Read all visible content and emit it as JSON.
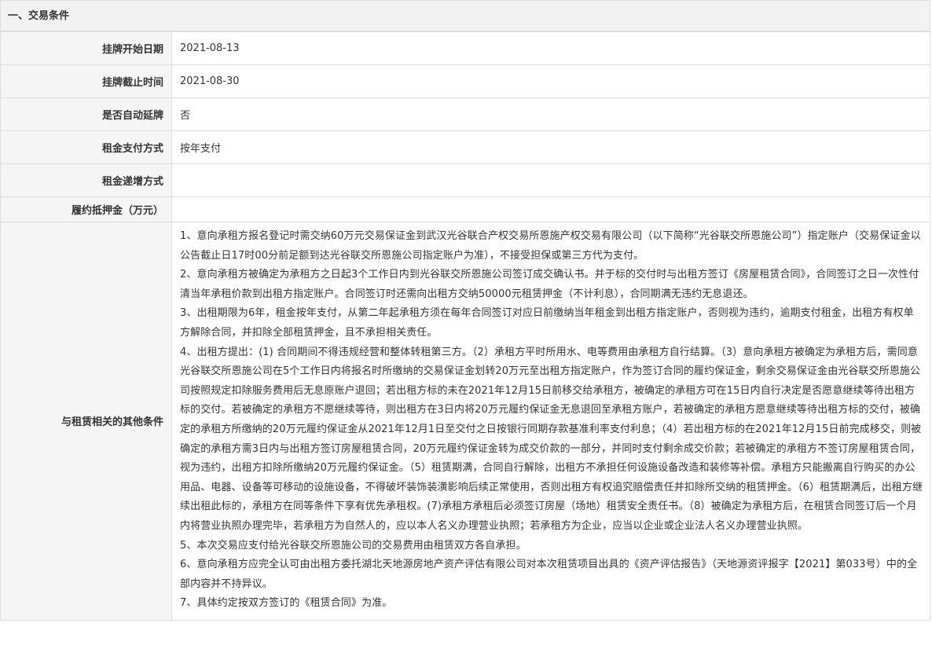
{
  "section": {
    "title": "一、交易条件"
  },
  "rows": [
    {
      "label": "挂牌开始日期",
      "value": "2021-08-13"
    },
    {
      "label": "挂牌截止时间",
      "value": "2021-08-30"
    },
    {
      "label": "是否自动延牌",
      "value": "否"
    },
    {
      "label": "租金支付方式",
      "value": "按年支付"
    },
    {
      "label": "租金递增方式",
      "value": ""
    },
    {
      "label": "履约抵押金（万元）",
      "value": ""
    }
  ],
  "other_conditions": {
    "label": "与租赁相关的其他条件",
    "paragraphs": [
      "1、意向承租方报名登记时需交纳60万元交易保证金到武汉光谷联合产权交易所恩施产权交易有限公司（以下简称“光谷联交所恩施公司”）指定账户（交易保证金以公告截止日17时00分前足额到达光谷联交所恩施公司指定账户为准），不接受担保或第三方代为支付。",
      " 2、意向承租方被确定为承租方之日起3个工作日内到光谷联交所恩施公司签订成交确认书。并于标的交付时与出租方签订《房屋租赁合同》，合同签订之日一次性付清当年承租价款到出租方指定账户。合同签订时还需向出租方交纳50000元租赁押金（不计利息），合同期满无违约无息退还。",
      "3、出租期限为6年，租金按年支付，从第二年起承租方须在每年合同签订对应日前缴纳当年租金到出租方指定账户，否则视为违约，逾期支付租金，出租方有权单方解除合同，并扣除全部租赁押金，且不承担相关责任。",
      "4、出租方提出：(1) 合同期间不得违规经营和整体转租第三方。（2）承租方平时所用水、电等费用由承租方自行结算。（3）意向承租方被确定为承租方后，需同意光谷联交所恩施公司在5个工作日内将报名时所缴纳的交易保证金划转20万元至出租方指定账户，作为签订合同的履约保证金，剩余交易保证金由光谷联交所恩施公司按照规定扣除服务费用后无息原账户退回；若出租方标的未在2021年12月15日前移交给承租方，被确定的承租方可在15日内自行决定是否愿意继续等待出租方标的交付。若被确定的承租方不愿继续等待，则出租方在3日内将20万元履约保证金无息退回至承租方账户，若被确定的承租方愿意继续等待出租方标的交付，被确定的承租方所缴纳的20万元履约保证金从2021年12月1日至交付之日按银行同期存款基准利率支付利息；（4）若出租方标的在2021年12月15日前完成移交，则被确定的承租方需3日内与出租方签订房屋租赁合同，20万元履约保证金转为成交价款的一部分，并同时支付剩余成交价款；若被确定的承租方不签订房屋租赁合同，视为违约，出租方扣除所缴纳20万元履约保证金。（5）租赁期满，合同自行解除，出租方不承担任何设施设备改造和装修等补偿。承租方只能搬离自行购买的办公用品、电器、设备等可移动的设施设备，不得破坏装饰装潢影响后续正常使用，否则出租方有权追究赔偿责任并扣除所交纳的租赁押金。（6）租赁期满后，出租方继续出租此标的，承租方在同等条件下享有优先承租权。(7)承租方承租后必须签订房屋（场地）租赁安全责任书。（8）被确定为承租方后，在租赁合同签订后一个月内将营业执照办理完毕，若承租方为自然人的，应以本人名义办理营业执照；若承租方为企业，应当以企业或企业法人名义办理营业执照。",
      "5、本次交易应支付给光谷联交所恩施公司的交易费用由租赁双方各自承担。",
      "6、意向承租方应完全认可由出租方委托湖北天地源房地产资产评估有限公司对本次租赁项目出具的《资产评估报告》（天地源资评报字【2021】第033号）中的全部内容并不持异议。",
      "7、具体约定按双方签订的《租赁合同》为准。"
    ]
  }
}
